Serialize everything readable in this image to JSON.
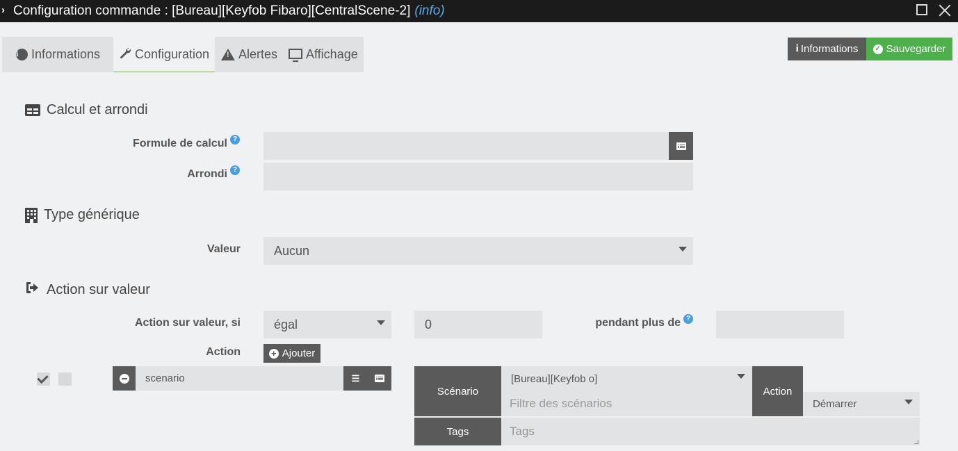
{
  "window": {
    "title": "Configuration commande : [Bureau][Keyfob Fibaro][CentralScene-2]",
    "type_tag": "(info)"
  },
  "tabs": [
    {
      "label": "Informations",
      "icon": "info-circle-icon"
    },
    {
      "label": "Configuration",
      "icon": "wrench-icon",
      "active": true
    },
    {
      "label": "Alertes",
      "icon": "warning-icon"
    },
    {
      "label": "Affichage",
      "icon": "desktop-icon"
    }
  ],
  "toolbar": {
    "info_label": "Informations",
    "save_label": "Sauvegarder"
  },
  "calcul": {
    "heading": "Calcul et arrondi",
    "formule_label": "Formule de calcul",
    "formule_value": "",
    "arrondi_label": "Arrondi",
    "arrondi_value": ""
  },
  "type_generique": {
    "heading": "Type générique",
    "valeur_label": "Valeur",
    "valeur_selected": "Aucun"
  },
  "action_sur_valeur": {
    "heading": "Action sur valeur",
    "condition_label": "Action sur valeur, si",
    "operator_selected": "égal",
    "compare_value": "0",
    "duration_label": "pendant plus de",
    "duration_value": "",
    "action_label": "Action",
    "add_label": "Ajouter"
  },
  "action_row": {
    "enabled": true,
    "parallel": false,
    "cmd_value": "scenario",
    "scenario_label": "Scénario",
    "scenario_selected": "[Bureau][Keyfob o]",
    "scenario_filter_placeholder": "Filtre des scénarios",
    "action_label": "Action",
    "action_selected": "Démarrer",
    "tags_label": "Tags",
    "tags_placeholder": "Tags"
  },
  "colors": {
    "titlebar_bg": "#1b1b1b",
    "save_green": "#4db04a",
    "dark_gray": "#5a5a5a",
    "help_blue": "#4a9ee0",
    "info_link": "#5fa8e8"
  }
}
